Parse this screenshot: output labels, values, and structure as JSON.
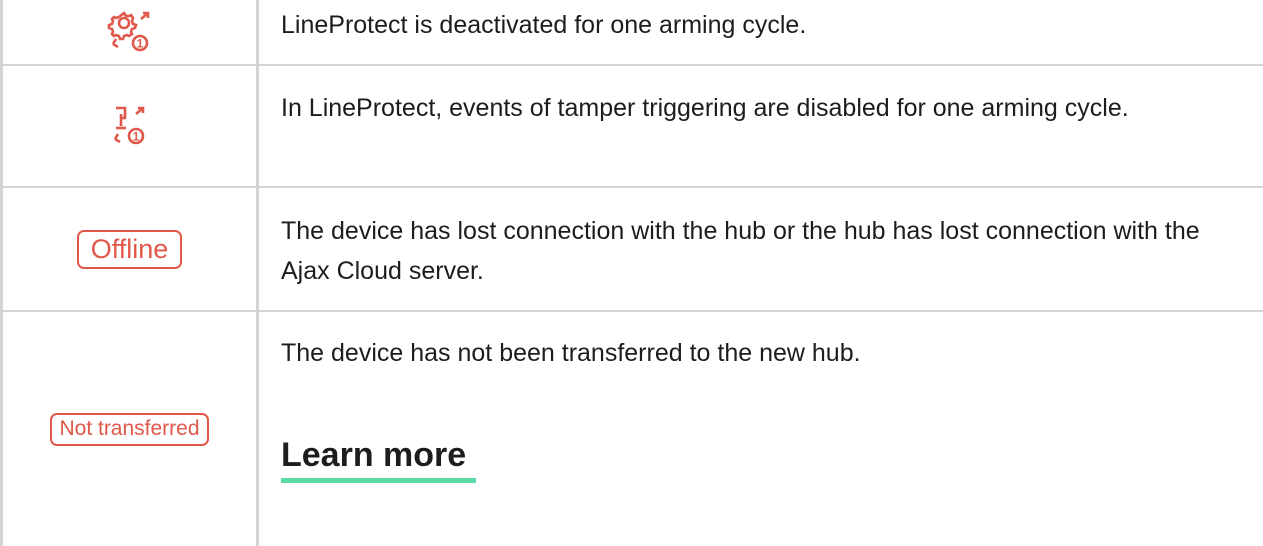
{
  "rows": [
    {
      "icon": "gear-one-cycle-icon",
      "text": "LineProtect is deactivated for one arming cycle."
    },
    {
      "icon": "tamper-one-cycle-icon",
      "text": "In LineProtect, events of tamper triggering are disabled for one arming cycle."
    },
    {
      "badge": "Offline",
      "text": "The device has lost connection with the hub or the hub has lost connection with the Ajax Cloud server."
    },
    {
      "badge": "Not transferred",
      "text": "The device has not been transferred to the new hub.",
      "link": "Learn more"
    }
  ],
  "colors": {
    "accent": "#e0584a",
    "link_underline": "#5ddba6",
    "border": "#d4d4d4",
    "text": "#1d1d1d"
  }
}
